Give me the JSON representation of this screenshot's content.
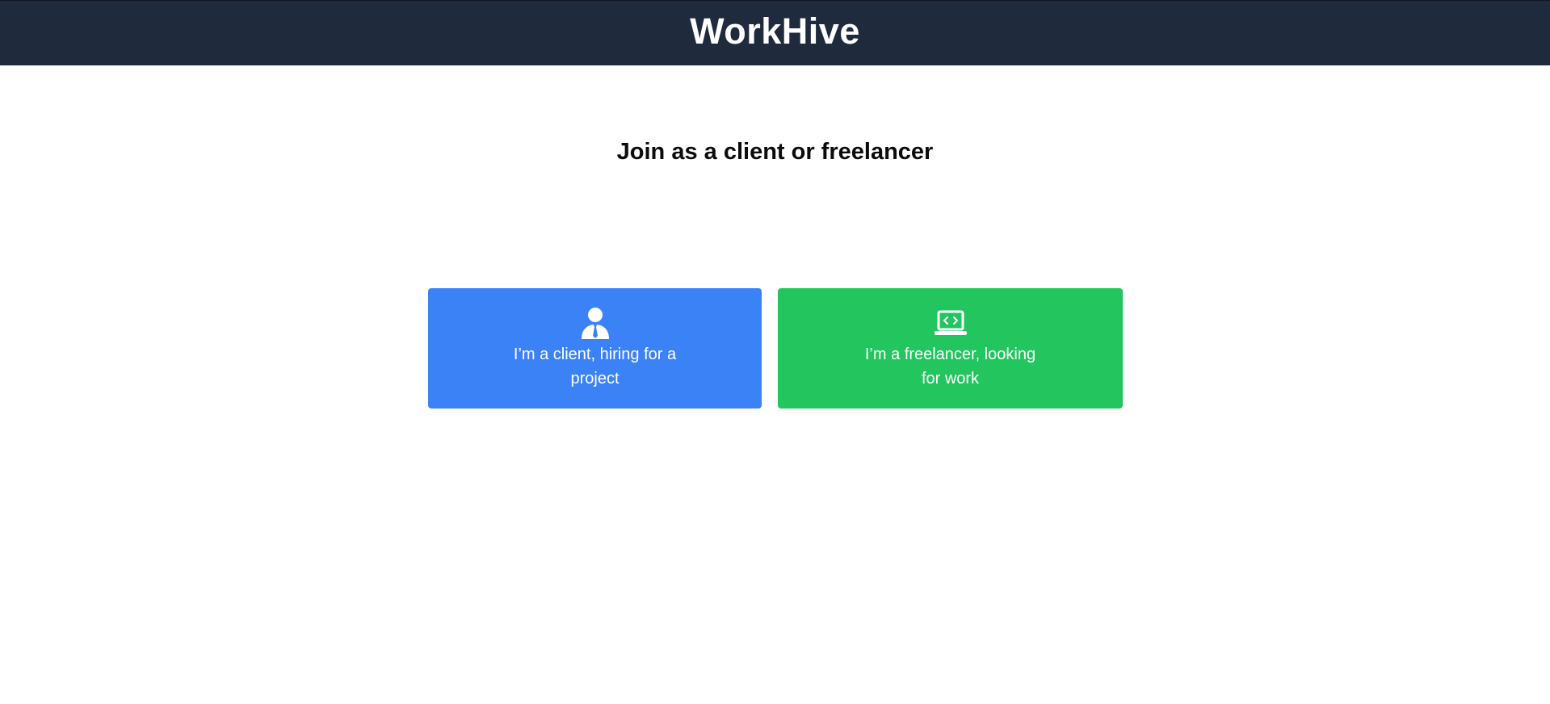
{
  "header": {
    "brand": "WorkHive",
    "background_color": "#1f2a3c"
  },
  "main": {
    "title": "Join as a client or freelancer",
    "roles": [
      {
        "label": "I’m a client, hiring for a project",
        "icon": "user-tie-icon",
        "color": "#3b82f6"
      },
      {
        "label": "I’m a freelancer, looking for work",
        "icon": "laptop-code-icon",
        "color": "#22c55e"
      }
    ]
  }
}
